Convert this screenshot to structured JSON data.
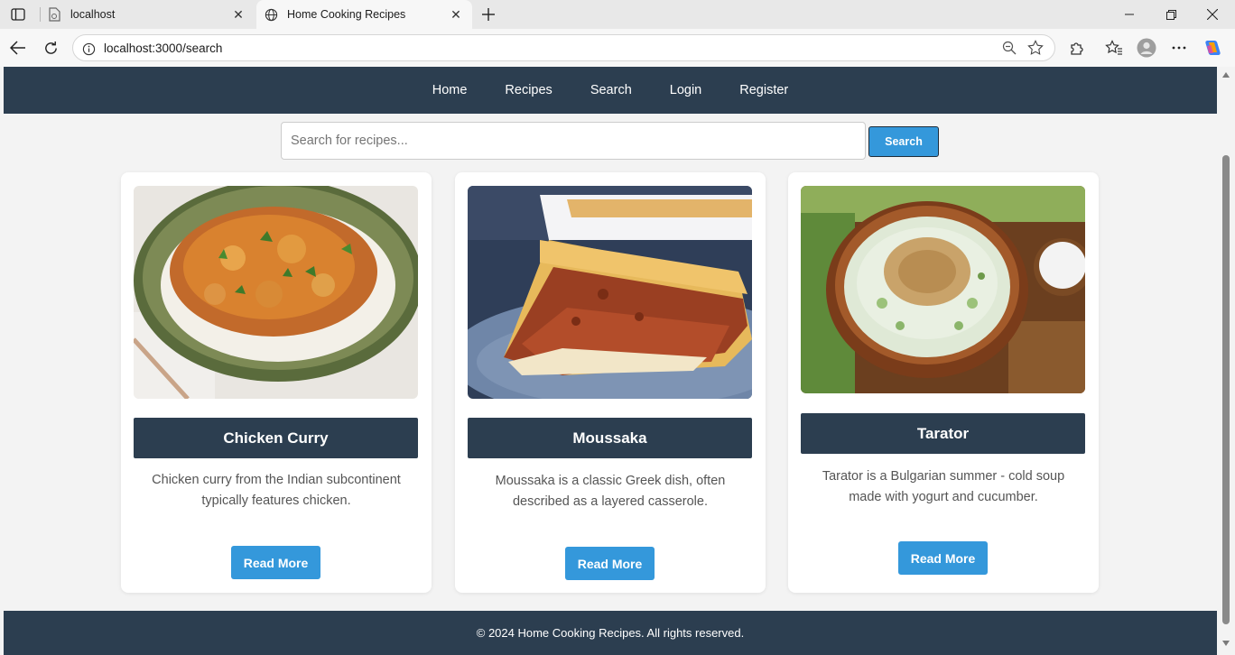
{
  "browser": {
    "tabs": [
      {
        "title": "localhost",
        "active": false
      },
      {
        "title": "Home Cooking Recipes",
        "active": true
      }
    ],
    "url": "localhost:3000/search"
  },
  "nav": {
    "links": [
      "Home",
      "Recipes",
      "Search",
      "Login",
      "Register"
    ]
  },
  "search": {
    "placeholder": "Search for recipes...",
    "value": "",
    "button_label": "Search"
  },
  "recipes": [
    {
      "title": "Chicken Curry",
      "description": "Chicken curry from the Indian subcontinent typically features chicken.",
      "button": "Read More"
    },
    {
      "title": "Moussaka",
      "description": "Moussaka is a classic Greek dish, often described as a layered casserole.",
      "button": "Read More"
    },
    {
      "title": "Tarator",
      "description": "Tarator is a Bulgarian summer - cold soup made with yogurt and cucumber.",
      "button": "Read More"
    }
  ],
  "footer": {
    "text": "© 2024 Home Cooking Recipes. All rights reserved."
  },
  "colors": {
    "nav_bg": "#2c3e50",
    "accent": "#3498db",
    "page_bg": "#f3f3f3"
  }
}
